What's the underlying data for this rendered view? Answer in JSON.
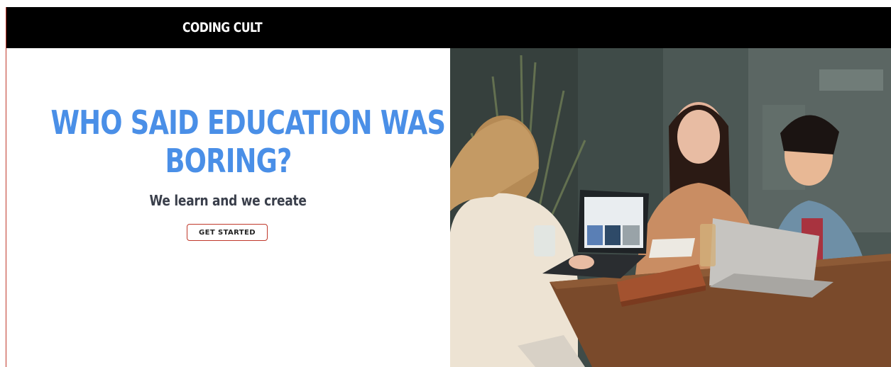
{
  "navbar": {
    "brand": "CODING CULT"
  },
  "hero": {
    "headline_line1": "WHO SAID EDUCATION WAS",
    "headline_line2": "BORING?",
    "subheadline": "We learn and we create",
    "cta_label": "GET STARTED"
  },
  "colors": {
    "headline": "#4a8fe7",
    "navbar_bg": "#000000",
    "cta_border": "#c0392b",
    "subheadline": "#3a3f4b"
  }
}
